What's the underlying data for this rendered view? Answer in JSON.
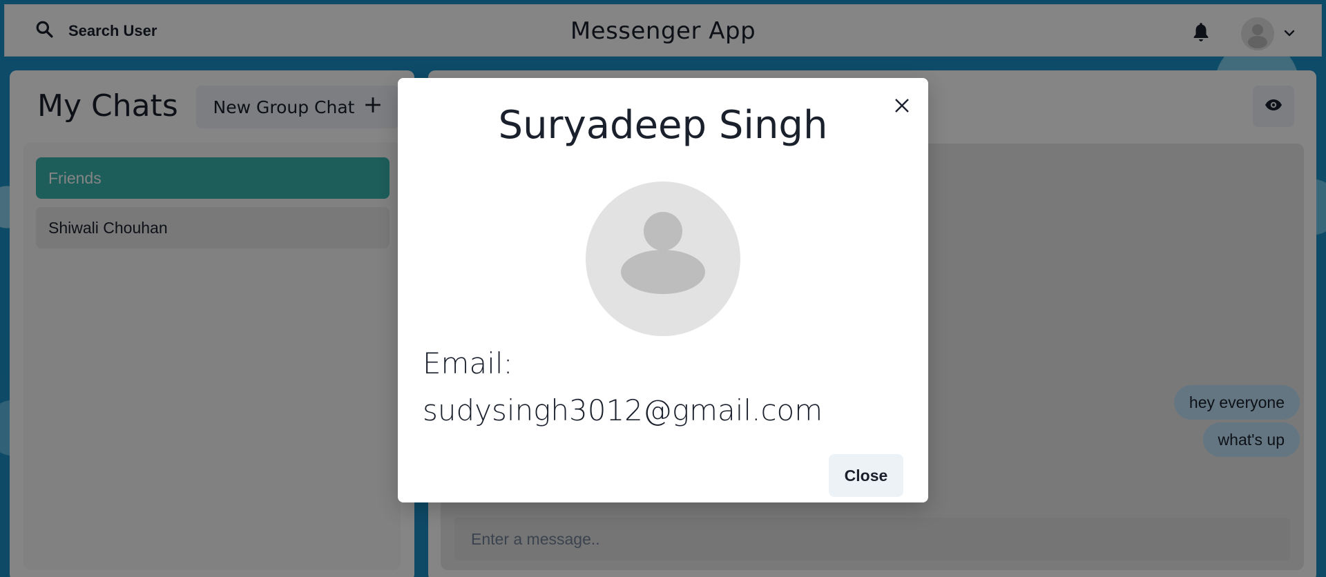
{
  "header": {
    "search_label": "Search User",
    "app_title": "Messenger App"
  },
  "chats": {
    "title": "My Chats",
    "new_group_label": "New Group Chat",
    "items": [
      {
        "label": "Friends",
        "active": true
      },
      {
        "label": "Shiwali Chouhan",
        "active": false
      }
    ]
  },
  "chat": {
    "messages": [
      {
        "text": "hey everyone"
      },
      {
        "text": "what's up"
      }
    ],
    "input_placeholder": "Enter a message.."
  },
  "modal": {
    "title": "Suryadeep Singh",
    "email_label": "Email:",
    "email_value": "sudysingh3012@gmail.com",
    "close_label": "Close"
  },
  "icons": {
    "search": "search-icon",
    "bell": "bell-icon",
    "avatar": "user-avatar",
    "chevron": "chevron-down-icon",
    "plus": "plus-icon",
    "eye": "eye-icon",
    "close": "close-icon"
  },
  "colors": {
    "accent": "#38b2ac",
    "bubble": "#bee3f8",
    "background": "#1a8fc4"
  }
}
